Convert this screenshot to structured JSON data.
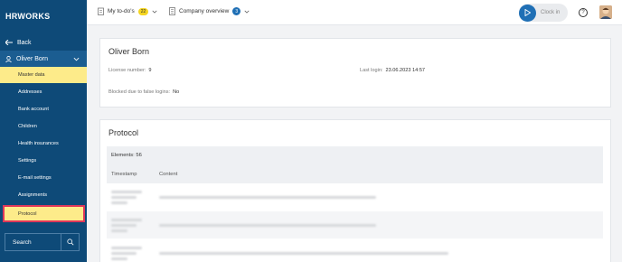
{
  "app": {
    "logo": "HRWORKS"
  },
  "sidebar": {
    "back_label": "Back",
    "user_label": "Oliver Born",
    "items": [
      {
        "label": "Master data"
      },
      {
        "label": "Addresses"
      },
      {
        "label": "Bank account"
      },
      {
        "label": "Children"
      },
      {
        "label": "Health insurances"
      },
      {
        "label": "Settings"
      },
      {
        "label": "E-mail settings"
      },
      {
        "label": "Assignments"
      },
      {
        "label": "Protocol"
      }
    ],
    "search_label": "Search"
  },
  "header": {
    "todos_label": "My to-do's",
    "todos_count": "22",
    "company_label": "Company overview",
    "company_count": "3",
    "clock_in_label": "Clock in",
    "help_glyph": "?"
  },
  "profile": {
    "name": "Oliver Born",
    "license_label": "License number:",
    "license_value": "9",
    "last_login_label": "Last login:",
    "last_login_value": "23.06.2023 14:57",
    "blocked_label": "Blocked due to false logins:",
    "blocked_value": "No"
  },
  "protocol": {
    "title": "Protocol",
    "elements_text": "Elements: 56",
    "columns": [
      "Timestamp",
      "Content"
    ]
  },
  "colors": {
    "sidebar_bg": "#0e4a78",
    "highlight": "#fdeb8a",
    "accent": "#1f6fb5",
    "badge_yellow": "#f5d520",
    "annotation_border": "#e0385a"
  }
}
